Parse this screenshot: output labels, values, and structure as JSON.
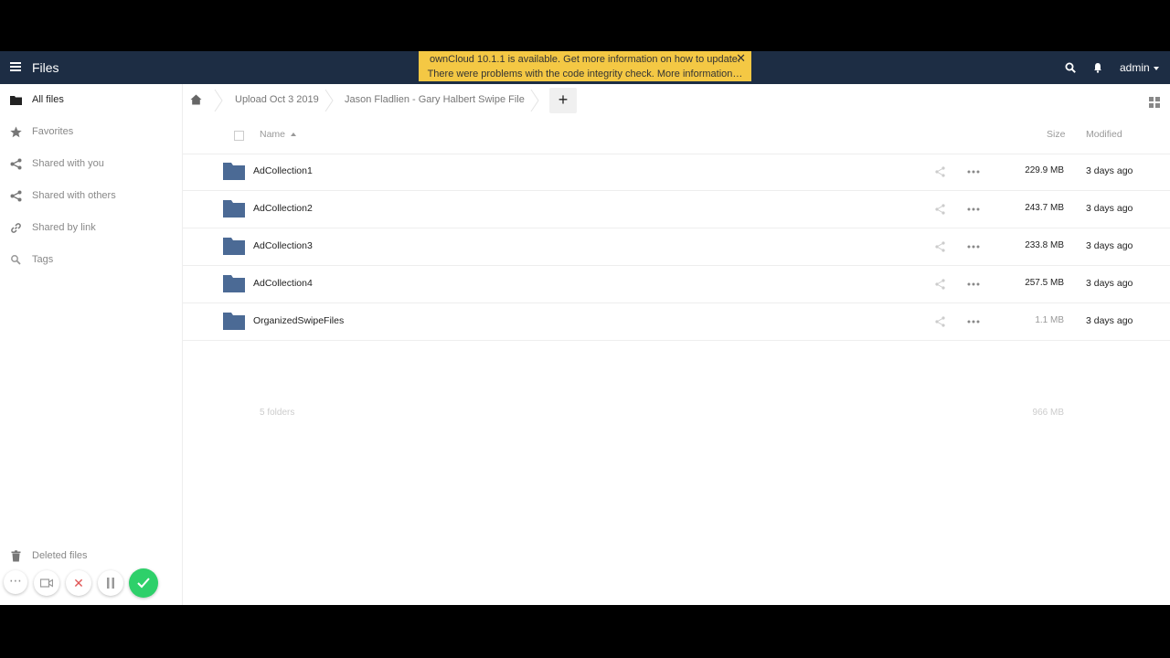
{
  "header": {
    "app_title": "Files",
    "notice_line1": "ownCloud 10.1.1 is available. Get more information on how to update.",
    "notice_line2": "There were problems with the code integrity check. More information…",
    "notice_close": "✕",
    "user": "admin"
  },
  "sidebar": {
    "items": [
      {
        "label": "All files",
        "icon": "folder-icon"
      },
      {
        "label": "Favorites",
        "icon": "star-icon"
      },
      {
        "label": "Shared with you",
        "icon": "share-icon"
      },
      {
        "label": "Shared with others",
        "icon": "share-icon"
      },
      {
        "label": "Shared by link",
        "icon": "link-icon"
      },
      {
        "label": "Tags",
        "icon": "tag-icon"
      }
    ],
    "deleted_files": "Deleted files"
  },
  "breadcrumb": {
    "items": [
      "Upload Oct 3 2019",
      "Jason Fladlien - Gary Halbert Swipe File"
    ],
    "add": "+"
  },
  "table": {
    "headers": {
      "name": "Name",
      "size": "Size",
      "modified": "Modified"
    },
    "rows": [
      {
        "name": "AdCollection1",
        "size": "229.9 MB",
        "modified": "3 days ago"
      },
      {
        "name": "AdCollection2",
        "size": "243.7 MB",
        "modified": "3 days ago"
      },
      {
        "name": "AdCollection3",
        "size": "233.8 MB",
        "modified": "3 days ago"
      },
      {
        "name": "AdCollection4",
        "size": "257.5 MB",
        "modified": "3 days ago"
      },
      {
        "name": "OrganizedSwipeFiles",
        "size": "1.1 MB",
        "modified": "3 days ago"
      }
    ],
    "summary_count": "5 folders",
    "summary_size": "966 MB"
  },
  "colors": {
    "header_bg": "#1d2d44",
    "notice_bg": "#f4c844",
    "folder": "#4b6a95",
    "record_ok": "#2ed06a"
  }
}
